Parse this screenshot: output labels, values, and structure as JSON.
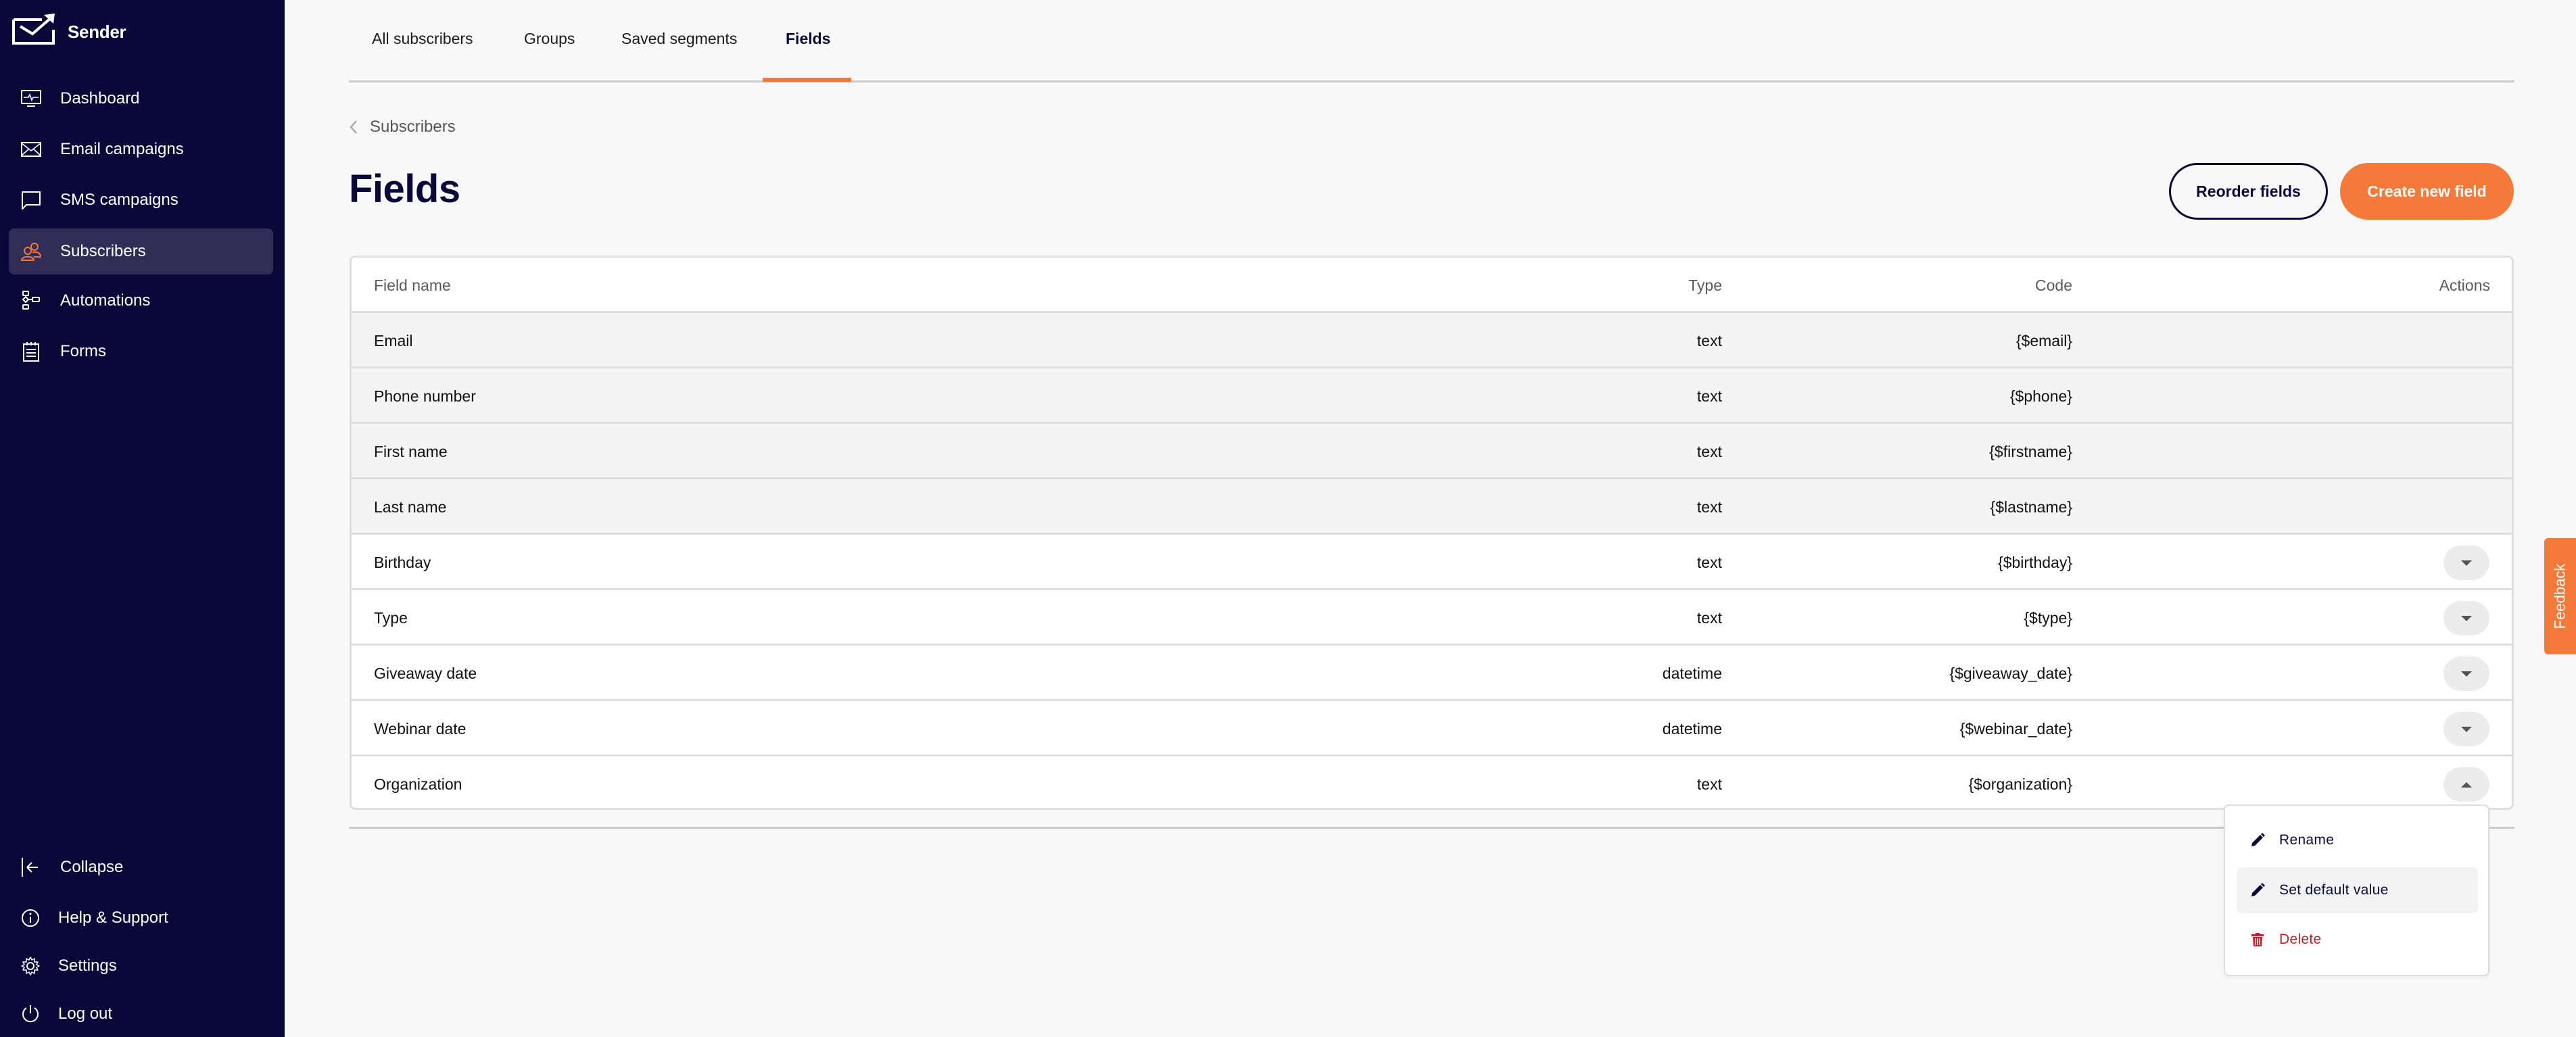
{
  "app": {
    "name": "Sender",
    "colors": {
      "sidebar": "#0a0839",
      "accent": "#f5793b",
      "active_nav": "#312d57",
      "danger": "#c42126"
    }
  },
  "sidebar": {
    "items": [
      {
        "label": "Dashboard",
        "icon": "dashboard-icon",
        "active": false
      },
      {
        "label": "Email campaigns",
        "icon": "email-icon",
        "active": false
      },
      {
        "label": "SMS campaigns",
        "icon": "chat-icon",
        "active": false
      },
      {
        "label": "Subscribers",
        "icon": "users-icon",
        "active": true
      },
      {
        "label": "Automations",
        "icon": "workflow-icon",
        "active": false
      },
      {
        "label": "Forms",
        "icon": "form-icon",
        "active": false
      }
    ],
    "bottom": [
      {
        "label": "Collapse",
        "icon": "collapse-icon"
      },
      {
        "label": "Help & Support",
        "icon": "info-icon"
      },
      {
        "label": "Settings",
        "icon": "gear-icon"
      },
      {
        "label": "Log out",
        "icon": "power-icon"
      }
    ]
  },
  "tabs": [
    {
      "label": "All subscribers",
      "active": false
    },
    {
      "label": "Groups",
      "active": false
    },
    {
      "label": "Saved segments",
      "active": false
    },
    {
      "label": "Fields",
      "active": true
    }
  ],
  "breadcrumb": {
    "label": "Subscribers"
  },
  "page": {
    "title": "Fields",
    "reorder_label": "Reorder fields",
    "create_label": "Create new field"
  },
  "table": {
    "columns": [
      "Field name",
      "Type",
      "Code",
      "Actions"
    ],
    "rows": [
      {
        "name": "Email",
        "type": "text",
        "code": "{$email}",
        "locked": true,
        "menu": null
      },
      {
        "name": "Phone number",
        "type": "text",
        "code": "{$phone}",
        "locked": true,
        "menu": null
      },
      {
        "name": "First name",
        "type": "text",
        "code": "{$firstname}",
        "locked": true,
        "menu": null
      },
      {
        "name": "Last name",
        "type": "text",
        "code": "{$lastname}",
        "locked": true,
        "menu": null
      },
      {
        "name": "Birthday",
        "type": "text",
        "code": "{$birthday}",
        "locked": false,
        "menu": "closed"
      },
      {
        "name": "Type",
        "type": "text",
        "code": "{$type}",
        "locked": false,
        "menu": "closed"
      },
      {
        "name": "Giveaway date",
        "type": "datetime",
        "code": "{$giveaway_date}",
        "locked": false,
        "menu": "closed"
      },
      {
        "name": "Webinar date",
        "type": "datetime",
        "code": "{$webinar_date}",
        "locked": false,
        "menu": "closed"
      },
      {
        "name": "Organization",
        "type": "text",
        "code": "{$organization}",
        "locked": false,
        "menu": "open"
      }
    ]
  },
  "dropdown": {
    "items": [
      {
        "label": "Rename",
        "icon": "pencil-icon",
        "highlighted": false
      },
      {
        "label": "Set default value",
        "icon": "pencil-icon",
        "highlighted": true
      },
      {
        "label": "Delete",
        "icon": "trash-icon",
        "highlighted": false,
        "danger": true
      }
    ]
  },
  "feedback": {
    "label": "Feedback"
  }
}
